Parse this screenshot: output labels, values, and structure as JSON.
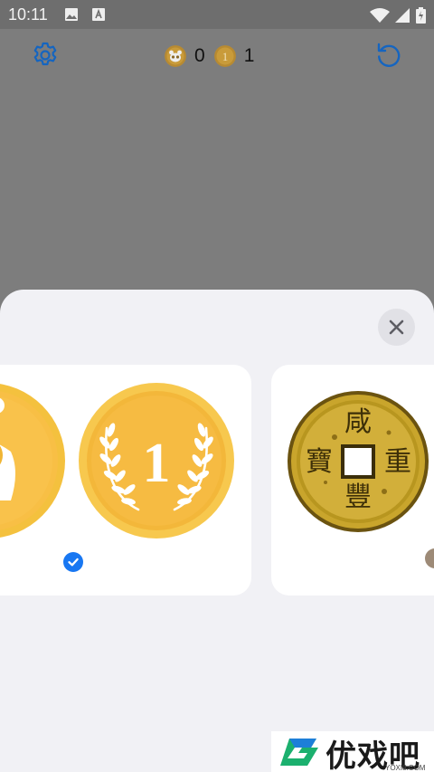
{
  "status_bar": {
    "time": "10:11",
    "icons": [
      "image-icon",
      "keyboard-a-icon",
      "wifi-icon",
      "signal-icon",
      "battery-charging-icon"
    ]
  },
  "header": {
    "settings_icon": "gear-icon",
    "score_panda_coins": "0",
    "score_one_coins": "1",
    "reset_icon": "reset-icon",
    "accent_color": "#1a73e8"
  },
  "sheet": {
    "close_icon": "close-icon",
    "options": [
      {
        "name": "panda-and-one-coins",
        "selected": true,
        "coins": [
          "panda-coin",
          "one-coin"
        ],
        "one_coin_label": "1"
      },
      {
        "name": "chinese-coin",
        "selected": false,
        "characters": [
          "咸",
          "豐",
          "重",
          "寶"
        ]
      }
    ],
    "selected_color": "#1877f2"
  },
  "watermark": {
    "text": "优戏吧",
    "subtext": "YOXI8.COM"
  }
}
